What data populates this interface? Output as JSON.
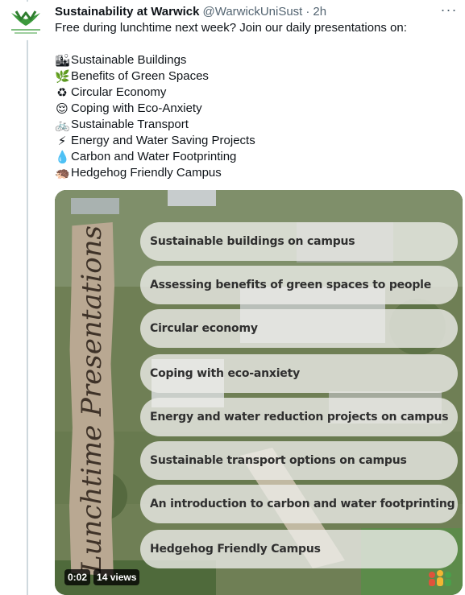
{
  "colors": {
    "accent_green": "#3d9a3d",
    "text_primary": "#0f1419",
    "text_secondary": "#536471",
    "thread_line": "#cfd9de"
  },
  "tweet": {
    "avatar": {
      "icon": "environmental-sustainability-logo",
      "caption": "ENVIRONMENTAL SUSTAINABILITY"
    },
    "author_name": "Sustainability at Warwick",
    "handle": "@WarwickUniSust",
    "separator": "·",
    "time": "2h",
    "more_icon": "more-horizontal-icon",
    "intro": "Free during lunchtime next week? Join our daily presentations on:",
    "topics": [
      {
        "emoji": "🏙",
        "icon": "cityscape-emoji",
        "label": "Sustainable Buildings"
      },
      {
        "emoji": "🌿",
        "icon": "herb-emoji",
        "label": "Benefits of Green Spaces"
      },
      {
        "emoji": "♻",
        "icon": "recycle-emoji",
        "label": "Circular Economy"
      },
      {
        "emoji": "😌",
        "icon": "relieved-face-emoji",
        "label": "Coping with Eco-Anxiety"
      },
      {
        "emoji": "🚲",
        "icon": "bicycle-emoji",
        "label": "Sustainable Transport"
      },
      {
        "emoji": "⚡",
        "icon": "lightning-emoji",
        "label": "Energy and Water Saving Projects"
      },
      {
        "emoji": "💧",
        "icon": "droplet-emoji",
        "label": "Carbon and Water Footprinting"
      },
      {
        "emoji": "🦔",
        "icon": "hedgehog-emoji",
        "label": "Hedgehog Friendly Campus"
      }
    ]
  },
  "video": {
    "banner_title": "Lunchtime Presentations",
    "slides": [
      "Sustainable buildings on campus",
      "Assessing  benefits of green spaces to people",
      "Circular economy",
      "Coping with eco-anxiety",
      "Energy and water reduction projects on campus",
      "Sustainable transport options on campus",
      "An introduction to carbon and water footprinting",
      "Hedgehog Friendly Campus"
    ],
    "duration": "0:02",
    "views": "14 views",
    "corner_icon": "community-people-icon"
  }
}
